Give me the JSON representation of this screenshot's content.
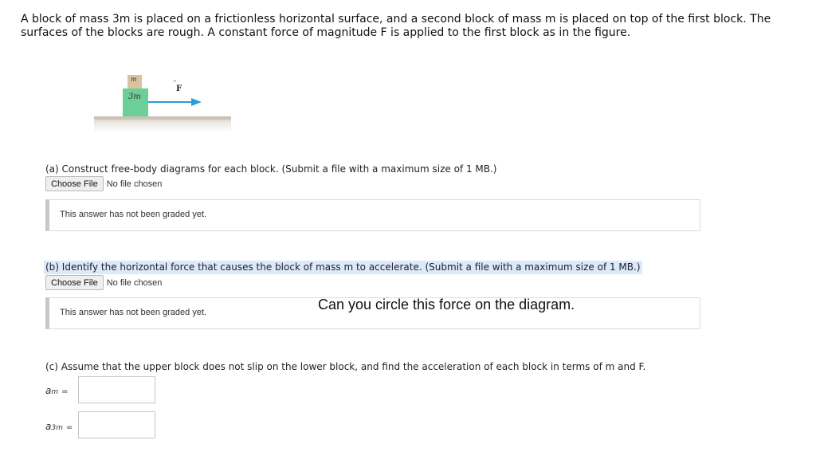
{
  "intro": "A block of mass 3m is placed on a frictionless horizontal surface, and a second block of mass m is placed on top of the first block. The surfaces of the blocks are rough. A constant force of magnitude F is applied to the first block as in the figure.",
  "figure": {
    "small_block_label": "m",
    "big_block_label": "3m",
    "force_label": "F",
    "force_vector_mark": "⃗",
    "colors": {
      "small_block": "#d9c4a2",
      "big_block": "#6ccf97",
      "arrow": "#2a9fd6"
    }
  },
  "part_a": {
    "label": "(a) Construct free-body diagrams for each block. (Submit a file with a maximum size of 1 MB.)",
    "choose_file": "Choose File",
    "no_file": "No file chosen",
    "grade_status": "This answer has not been graded yet."
  },
  "part_b": {
    "label": "(b) Identify the horizontal force that causes the block of mass m to accelerate. (Submit a file with a maximum size of 1 MB.)",
    "choose_file": "Choose File",
    "no_file": "No file chosen",
    "grade_status": "This answer has not been graded yet.",
    "note": "Can you circle this force on the diagram."
  },
  "part_c": {
    "label": "(c) Assume that the upper block does not slip on the lower block, and find the acceleration of each block in terms of m and F.",
    "a_m": {
      "var": "a",
      "sub": "m",
      "eq": "=",
      "value": ""
    },
    "a_3m": {
      "var": "a",
      "sub": "3m",
      "eq": "=",
      "value": ""
    }
  }
}
